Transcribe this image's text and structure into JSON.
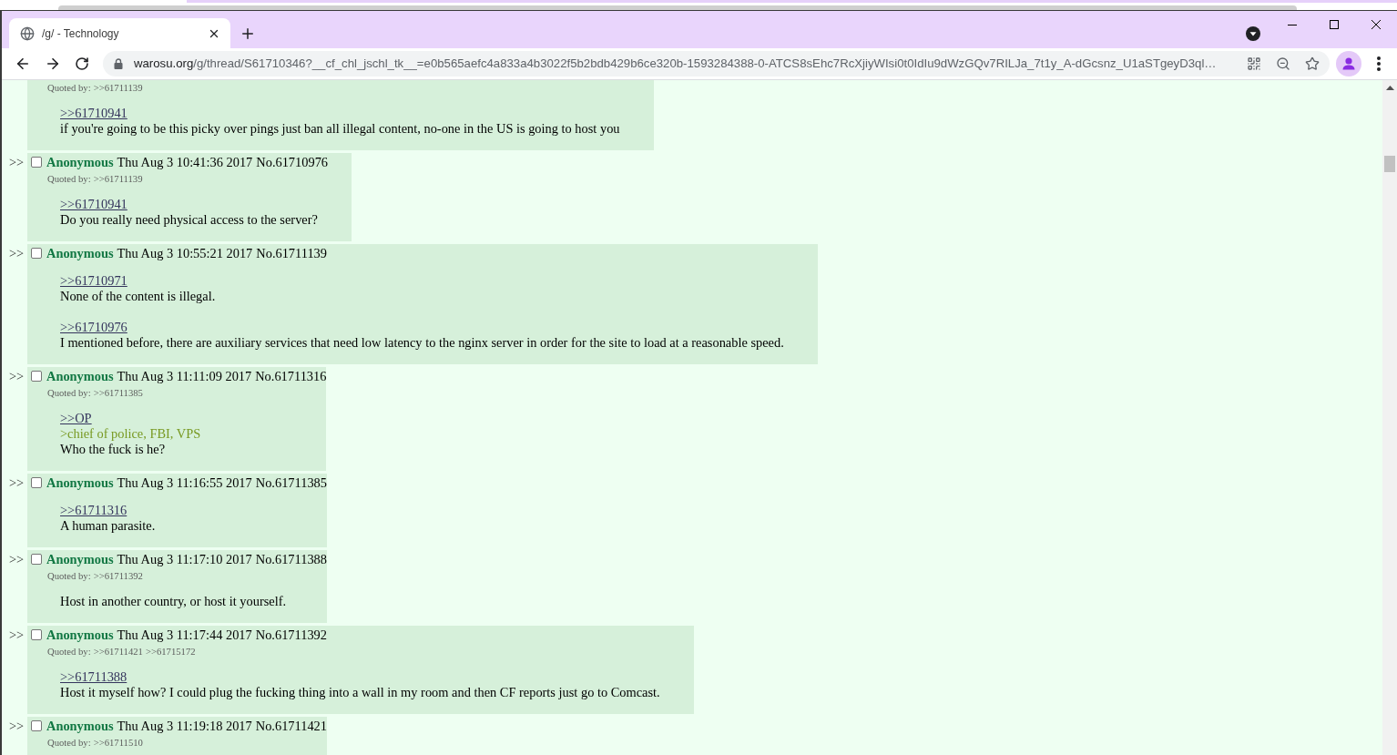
{
  "browser": {
    "tab": {
      "title": "/g/ - Technology",
      "selected": true
    },
    "address_bar": {
      "domain": "warosu.org",
      "path": "/g/thread/S61710346?__cf_chl_jschl_tk__=e0b565aefc4a833a4b3022f5b2bdb429b6ce320b-1593284388-0-ATCS8sEhc7RcXjiyWIsi0t0IdIu9dWzGQv7RILJa_7t1y_A-dGcsnz_U1aSTgeyD3ql…"
    }
  },
  "thread": {
    "posts": [
      {
        "quoted_by_label": "Quoted by:",
        "quoted_by": [
          ">>61711139"
        ],
        "body": [
          [
            {
              "kind": "quotelink",
              "text": ">>61710941"
            },
            {
              "kind": "text",
              "text": "if you're going to be this picky over pings just ban all illegal content, no-one in the US is going to host you"
            }
          ]
        ]
      },
      {
        "marker": ">>",
        "checked": false,
        "name": "Anonymous",
        "date": "Thu Aug 3 10:41:36 2017",
        "number": "No.61710976",
        "quoted_by_label": "Quoted by:",
        "quoted_by": [
          ">>61711139"
        ],
        "body": [
          [
            {
              "kind": "quotelink",
              "text": ">>61710941"
            },
            {
              "kind": "text",
              "text": "Do you really need physical access to the server?"
            }
          ]
        ]
      },
      {
        "marker": ">>",
        "checked": false,
        "name": "Anonymous",
        "date": "Thu Aug 3 10:55:21 2017",
        "number": "No.61711139",
        "body": [
          [
            {
              "kind": "quotelink",
              "text": ">>61710971"
            },
            {
              "kind": "text",
              "text": "None of the content is illegal."
            }
          ],
          [
            {
              "kind": "quotelink",
              "text": ">>61710976"
            },
            {
              "kind": "text",
              "text": "I mentioned before, there are auxiliary services that need low latency to the nginx server in order for the site to load at a reasonable speed."
            }
          ]
        ]
      },
      {
        "marker": ">>",
        "checked": false,
        "name": "Anonymous",
        "date": "Thu Aug 3 11:11:09 2017",
        "number": "No.61711316",
        "quoted_by_label": "Quoted by:",
        "quoted_by": [
          ">>61711385"
        ],
        "body": [
          [
            {
              "kind": "quotelink",
              "text": ">>OP"
            },
            {
              "kind": "greentext",
              "text": ">chief of police, FBI, VPS"
            },
            {
              "kind": "text",
              "text": "Who the fuck is he?"
            }
          ]
        ]
      },
      {
        "marker": ">>",
        "checked": false,
        "name": "Anonymous",
        "date": "Thu Aug 3 11:16:55 2017",
        "number": "No.61711385",
        "body": [
          [
            {
              "kind": "quotelink",
              "text": ">>61711316"
            },
            {
              "kind": "text",
              "text": "A human parasite."
            }
          ]
        ]
      },
      {
        "marker": ">>",
        "checked": false,
        "name": "Anonymous",
        "date": "Thu Aug 3 11:17:10 2017",
        "number": "No.61711388",
        "quoted_by_label": "Quoted by:",
        "quoted_by": [
          ">>61711392"
        ],
        "body": [
          [
            {
              "kind": "text",
              "text": "Host in another country, or host it yourself."
            }
          ]
        ]
      },
      {
        "marker": ">>",
        "checked": false,
        "name": "Anonymous",
        "date": "Thu Aug 3 11:17:44 2017",
        "number": "No.61711392",
        "quoted_by_label": "Quoted by:",
        "quoted_by": [
          ">>61711421",
          ">>61715172"
        ],
        "body": [
          [
            {
              "kind": "quotelink",
              "text": ">>61711388"
            },
            {
              "kind": "text",
              "text": "Host it myself how? I could plug the fucking thing into a wall in my room and then CF reports just go to Comcast."
            }
          ]
        ]
      },
      {
        "marker": ">>",
        "checked": false,
        "name": "Anonymous",
        "date": "Thu Aug 3 11:19:18 2017",
        "number": "No.61711421",
        "quoted_by_label": "Quoted by:",
        "quoted_by": [
          ">>61711510"
        ]
      }
    ]
  }
}
